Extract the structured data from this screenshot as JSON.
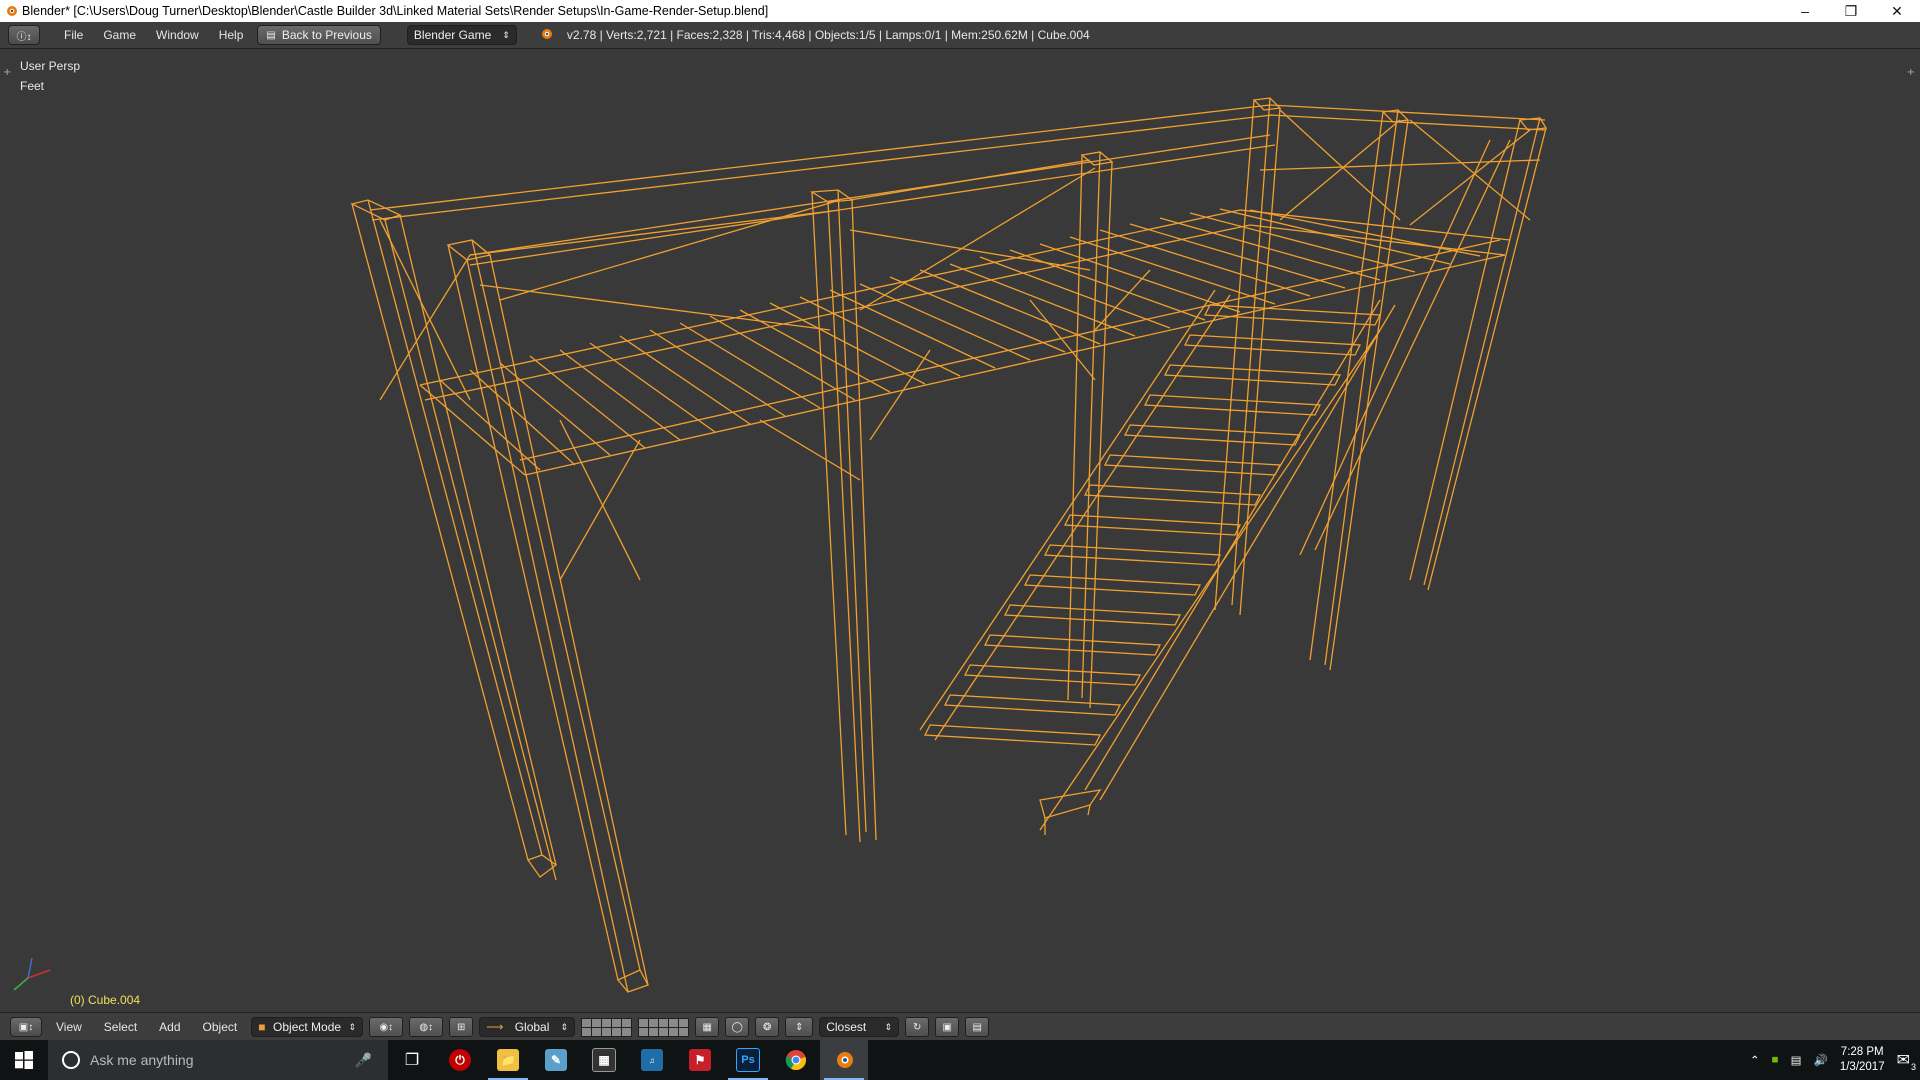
{
  "window": {
    "title": "Blender* [C:\\Users\\Doug Turner\\Desktop\\Blender\\Castle Builder 3d\\Linked Material Sets\\Render Setups\\In-Game-Render-Setup.blend]"
  },
  "info_header": {
    "menus": [
      "File",
      "Game",
      "Window",
      "Help"
    ],
    "back_button": "Back to Previous",
    "engine": "Blender Game",
    "stats": "v2.78 | Verts:2,721 | Faces:2,328 | Tris:4,468 | Objects:1/5 | Lamps:0/1 | Mem:250.62M | Cube.004"
  },
  "viewport": {
    "view_name": "User Persp",
    "units": "Feet",
    "active_object": "(0) Cube.004",
    "wire_color": "#f0a030"
  },
  "view3d_header": {
    "menus": [
      "View",
      "Select",
      "Add",
      "Object"
    ],
    "mode": "Object Mode",
    "orientation": "Global",
    "snap_target": "Closest"
  },
  "taskbar": {
    "search_placeholder": "Ask me anything",
    "time": "7:28 PM",
    "date": "1/3/2017",
    "notification_count": "3"
  },
  "colors": {
    "viewport_bg": "#393939",
    "header_bg": "#3d3d3d",
    "active_text": "#f0e05c"
  }
}
